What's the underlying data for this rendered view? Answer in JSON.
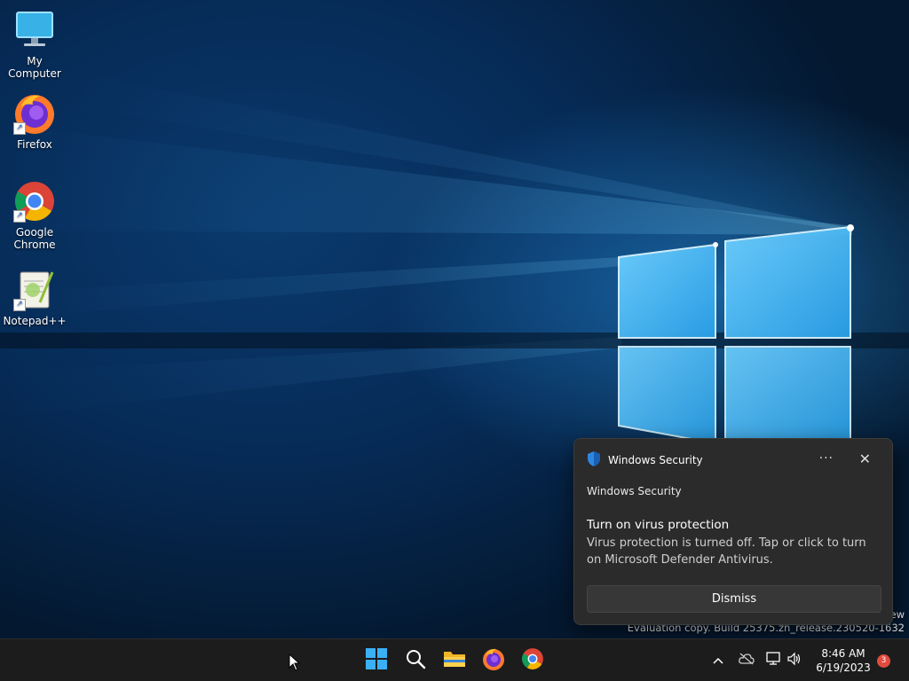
{
  "desktop": {
    "icons": [
      {
        "label": "My Computer",
        "icon": "monitor-icon"
      },
      {
        "label": "Firefox",
        "icon": "firefox-icon"
      },
      {
        "label": "Google Chrome",
        "icon": "chrome-icon"
      },
      {
        "label": "Notepad++",
        "icon": "notepad-plus-plus-icon"
      }
    ],
    "watermark": {
      "line1": "ew",
      "line2": "Evaluation copy. Build 25375.zn_release.230520-1632"
    }
  },
  "notification": {
    "app_name": "Windows Security",
    "app_icon": "shield-icon",
    "more_label": "···",
    "close_label": "✕",
    "source": "Windows Security",
    "title": "Turn on virus protection",
    "body": "Virus protection is turned off. Tap or click to turn on Microsoft Defender Antivirus.",
    "dismiss_label": "Dismiss"
  },
  "taskbar": {
    "pinned": [
      {
        "name": "start",
        "icon": "windows-start-icon"
      },
      {
        "name": "search",
        "icon": "search-icon"
      },
      {
        "name": "file-explorer",
        "icon": "folder-icon"
      },
      {
        "name": "firefox",
        "icon": "firefox-icon"
      },
      {
        "name": "chrome",
        "icon": "chrome-icon"
      }
    ],
    "tray": {
      "chevron": "^",
      "time": "8:46 AM",
      "date": "6/19/2023",
      "notification_count": "3"
    }
  },
  "colors": {
    "accent": "#0078d4",
    "taskbar": "#1c1c1c",
    "toast_bg": "#2b2b2b",
    "badge": "#e04b3f"
  }
}
